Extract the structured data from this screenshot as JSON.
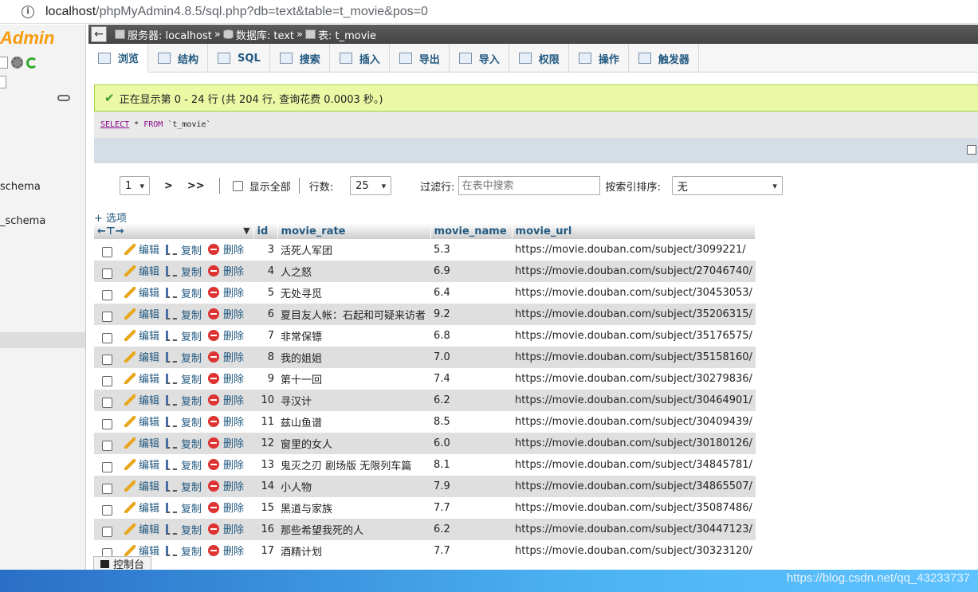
{
  "browser": {
    "url_host": "localhost",
    "url_rest": "/phpMyAdmin4.8.5/sql.php?db=text&table=t_movie&pos=0"
  },
  "sidebar": {
    "logo": "Admin",
    "databases": [
      "schema",
      "_schema"
    ]
  },
  "breadcrumb": {
    "server": "服务器: localhost",
    "database": "数据库: text",
    "table": "表: t_movie",
    "separator": "»"
  },
  "tabs": [
    {
      "label": "浏览",
      "icon": "browse-icon"
    },
    {
      "label": "结构",
      "icon": "structure-icon"
    },
    {
      "label": "SQL",
      "icon": "sql-icon"
    },
    {
      "label": "搜索",
      "icon": "search-icon"
    },
    {
      "label": "插入",
      "icon": "insert-icon"
    },
    {
      "label": "导出",
      "icon": "export-icon"
    },
    {
      "label": "导入",
      "icon": "import-icon"
    },
    {
      "label": "权限",
      "icon": "privileges-icon"
    },
    {
      "label": "操作",
      "icon": "wrench-icon"
    },
    {
      "label": "触发器",
      "icon": "triggers-icon"
    }
  ],
  "message": "正在显示第 0 - 24 行 (共 204 行, 查询花费 0.0003 秒。)",
  "sql": {
    "select": "SELECT",
    "star": "*",
    "from": "FROM",
    "table": "`t_movie`"
  },
  "navigation": {
    "page": "1",
    "next": ">",
    "last": ">>",
    "show_all": "显示全部",
    "rows_label": "行数:",
    "rows_value": "25",
    "filter_label": "过滤行:",
    "filter_placeholder": "在表中搜索",
    "sort_label": "按索引排序:",
    "sort_value": "无"
  },
  "options_link": "+ 选项",
  "table": {
    "columns": [
      "id",
      "movie_rate",
      "movie_name",
      "movie_url"
    ],
    "actions": {
      "edit": "编辑",
      "copy": "复制",
      "delete": "删除"
    },
    "rows": [
      {
        "id": "3",
        "movie_rate": "活死人军团",
        "movie_name": "5.3",
        "movie_url": "https://movie.douban.com/subject/3099221/"
      },
      {
        "id": "4",
        "movie_rate": "人之怒",
        "movie_name": "6.9",
        "movie_url": "https://movie.douban.com/subject/27046740/"
      },
      {
        "id": "5",
        "movie_rate": "无处寻觅",
        "movie_name": "6.4",
        "movie_url": "https://movie.douban.com/subject/30453053/"
      },
      {
        "id": "6",
        "movie_rate": "夏目友人帐：石起和可疑来访者",
        "movie_name": "9.2",
        "movie_url": "https://movie.douban.com/subject/35206315/"
      },
      {
        "id": "7",
        "movie_rate": "非常保镖",
        "movie_name": "6.8",
        "movie_url": "https://movie.douban.com/subject/35176575/"
      },
      {
        "id": "8",
        "movie_rate": "我的姐姐",
        "movie_name": "7.0",
        "movie_url": "https://movie.douban.com/subject/35158160/"
      },
      {
        "id": "9",
        "movie_rate": "第十一回",
        "movie_name": "7.4",
        "movie_url": "https://movie.douban.com/subject/30279836/"
      },
      {
        "id": "10",
        "movie_rate": "寻汉计",
        "movie_name": "6.2",
        "movie_url": "https://movie.douban.com/subject/30464901/"
      },
      {
        "id": "11",
        "movie_rate": "兹山鱼谱",
        "movie_name": "8.5",
        "movie_url": "https://movie.douban.com/subject/30409439/"
      },
      {
        "id": "12",
        "movie_rate": "窗里的女人",
        "movie_name": "6.0",
        "movie_url": "https://movie.douban.com/subject/30180126/"
      },
      {
        "id": "13",
        "movie_rate": "鬼灭之刃 剧场版 无限列车篇",
        "movie_name": "8.1",
        "movie_url": "https://movie.douban.com/subject/34845781/"
      },
      {
        "id": "14",
        "movie_rate": "小人物",
        "movie_name": "7.9",
        "movie_url": "https://movie.douban.com/subject/34865507/"
      },
      {
        "id": "15",
        "movie_rate": "黑道与家族",
        "movie_name": "7.7",
        "movie_url": "https://movie.douban.com/subject/35087486/"
      },
      {
        "id": "16",
        "movie_rate": "那些希望我死的人",
        "movie_name": "6.2",
        "movie_url": "https://movie.douban.com/subject/30447123/"
      },
      {
        "id": "17",
        "movie_rate": "酒精计划",
        "movie_name": "7.7",
        "movie_url": "https://movie.douban.com/subject/30323120/"
      }
    ]
  },
  "console": "控制台",
  "taskbar_watermark": "https://blog.csdn.net/qq_43233737"
}
